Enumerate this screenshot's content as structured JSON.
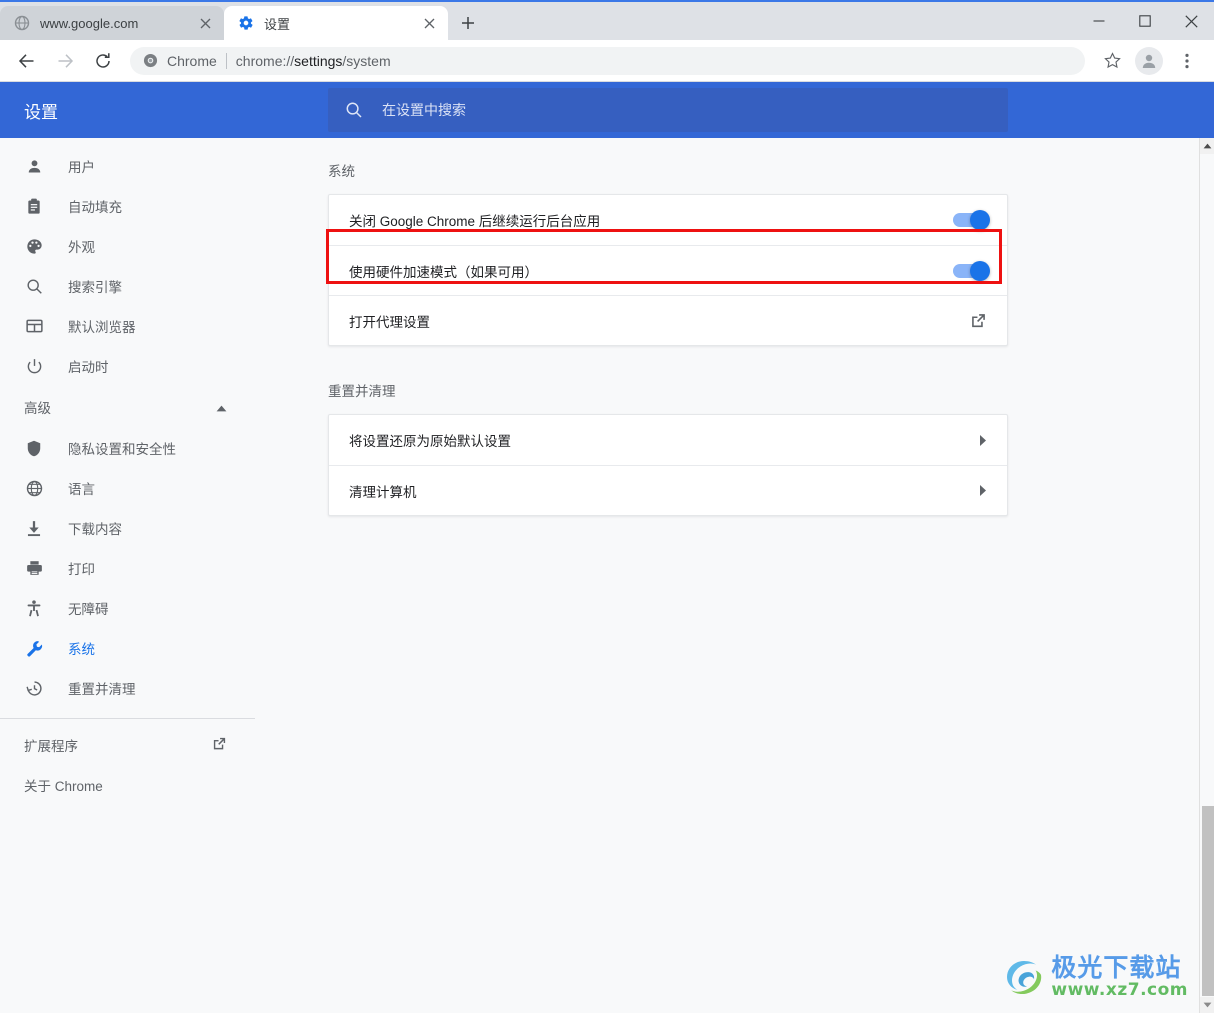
{
  "browser": {
    "tabs": [
      {
        "title": "www.google.com",
        "favicon": "globe-icon",
        "active": false
      },
      {
        "title": "设置",
        "favicon": "gear-icon",
        "active": true
      }
    ],
    "new_tab_label": "+",
    "window_controls": {
      "minimize": "−",
      "maximize": "□",
      "close": "✕"
    },
    "toolbar": {
      "back": "←",
      "forward": "→",
      "reload": "⟳",
      "bookmark": "☆",
      "menu": "⋮"
    },
    "omnibox": {
      "scheme_label": "Chrome",
      "url_prefix": "chrome://",
      "url_strong": "settings",
      "url_suffix": "/system"
    }
  },
  "settings_header": {
    "title": "设置",
    "search_placeholder": "在设置中搜索"
  },
  "sidebar": {
    "items": [
      {
        "label": "用户",
        "icon": "person-icon",
        "selected": false
      },
      {
        "label": "自动填充",
        "icon": "clipboard-icon",
        "selected": false
      },
      {
        "label": "外观",
        "icon": "palette-icon",
        "selected": false
      },
      {
        "label": "搜索引擎",
        "icon": "search-icon",
        "selected": false
      },
      {
        "label": "默认浏览器",
        "icon": "browser-window-icon",
        "selected": false
      },
      {
        "label": "启动时",
        "icon": "power-icon",
        "selected": false
      }
    ],
    "advanced_section": {
      "label": "高级",
      "expanded": true,
      "items": [
        {
          "label": "隐私设置和安全性",
          "icon": "shield-icon",
          "selected": false
        },
        {
          "label": "语言",
          "icon": "globe-icon",
          "selected": false
        },
        {
          "label": "下载内容",
          "icon": "download-icon",
          "selected": false
        },
        {
          "label": "打印",
          "icon": "printer-icon",
          "selected": false
        },
        {
          "label": "无障碍",
          "icon": "accessibility-icon",
          "selected": false
        },
        {
          "label": "系统",
          "icon": "wrench-icon",
          "selected": true
        },
        {
          "label": "重置并清理",
          "icon": "history-restore-icon",
          "selected": false
        }
      ]
    },
    "footer": [
      {
        "label": "扩展程序",
        "icon": "external-link-icon"
      },
      {
        "label": "关于 Chrome",
        "icon": ""
      }
    ]
  },
  "main": {
    "sections": [
      {
        "title": "系统",
        "rows": [
          {
            "label": "关闭 Google Chrome 后继续运行后台应用",
            "control": "toggle",
            "value": "on",
            "highlighted": false
          },
          {
            "label": "使用硬件加速模式（如果可用）",
            "control": "toggle",
            "value": "on",
            "highlighted": true
          },
          {
            "label": "打开代理设置",
            "control": "external-link-icon",
            "value": "",
            "highlighted": false
          }
        ]
      },
      {
        "title": "重置并清理",
        "rows": [
          {
            "label": "将设置还原为原始默认设置",
            "control": "chevron-right-icon",
            "value": "",
            "highlighted": false
          },
          {
            "label": "清理计算机",
            "control": "chevron-right-icon",
            "value": "",
            "highlighted": false
          }
        ]
      }
    ]
  },
  "annotation": {
    "type": "red-rectangle",
    "color": "#ee1111",
    "targets_row": "使用硬件加速模式（如果可用）"
  },
  "watermark": {
    "main": "极光下载站",
    "sub": "www.xz7.com"
  },
  "colors": {
    "header_blue": "#3367d6",
    "accent_blue": "#1a73e8",
    "toggle_track": "#8ab4f8",
    "page_background": "#f8f9fa",
    "annotation_red": "#ee1111"
  }
}
